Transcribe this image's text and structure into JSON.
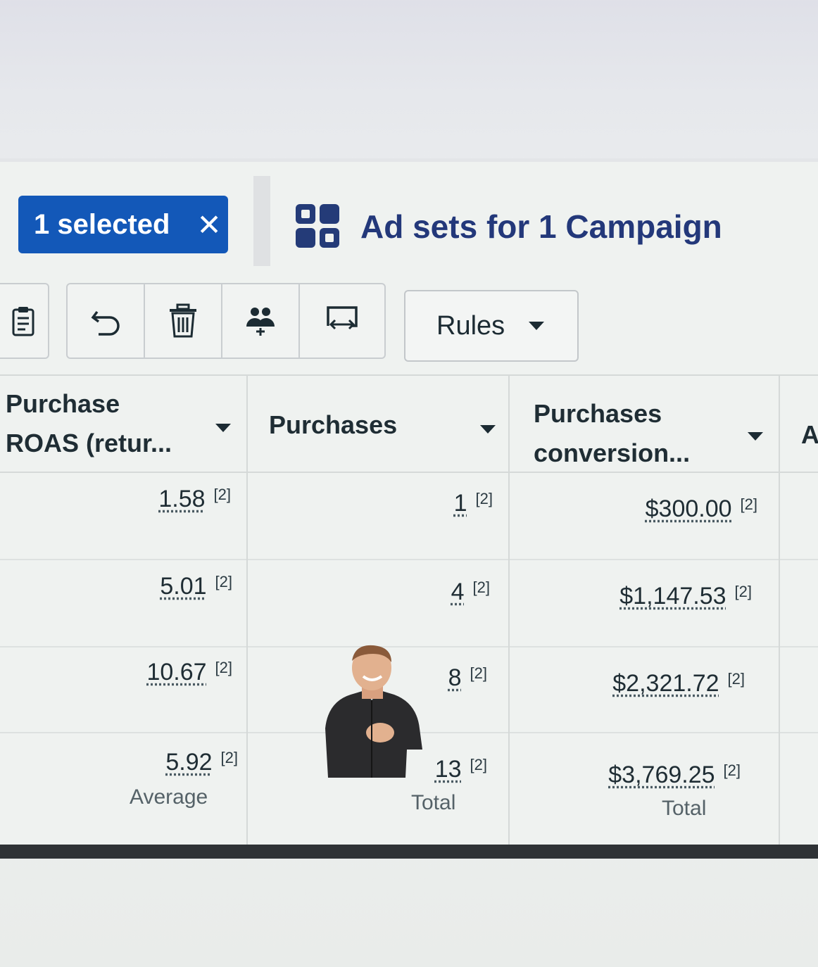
{
  "selection": {
    "label": "1 selected",
    "close_glyph": "✕"
  },
  "breadcrumb": {
    "title": "Ad sets for 1 Campaign",
    "icon": "ad-sets-grid-icon"
  },
  "toolbar": {
    "icons": [
      "clipboard-icon",
      "undo-icon",
      "trash-icon",
      "audience-icon",
      "swap-icon"
    ],
    "rules_label": "Rules"
  },
  "table": {
    "columns": [
      {
        "line1": "Purchase",
        "line2": "ROAS (retur..."
      },
      {
        "line1": "Purchases",
        "line2": ""
      },
      {
        "line1": "Purchases",
        "line2": "conversion..."
      },
      {
        "line1": "A",
        "line2": ""
      }
    ],
    "rows": [
      {
        "roas": "1.58",
        "roas_ref": "[2]",
        "purchases": "1",
        "purchases_ref": "[2]",
        "value": "$300.00",
        "value_ref": "[2]"
      },
      {
        "roas": "5.01",
        "roas_ref": "[2]",
        "purchases": "4",
        "purchases_ref": "[2]",
        "value": "$1,147.53",
        "value_ref": "[2]"
      },
      {
        "roas": "10.67",
        "roas_ref": "[2]",
        "purchases": "8",
        "purchases_ref": "[2]",
        "value": "$2,321.72",
        "value_ref": "[2]"
      }
    ],
    "summary": {
      "roas": "5.92",
      "roas_ref": "[2]",
      "roas_label": "Average",
      "purchases": "13",
      "purchases_ref": "[2]",
      "purchases_label": "Total",
      "value": "$3,769.25",
      "value_ref": "[2]",
      "value_label": "Total"
    }
  },
  "colors": {
    "accent": "#1358b8",
    "title": "#23387a",
    "text": "#1c2b33"
  }
}
